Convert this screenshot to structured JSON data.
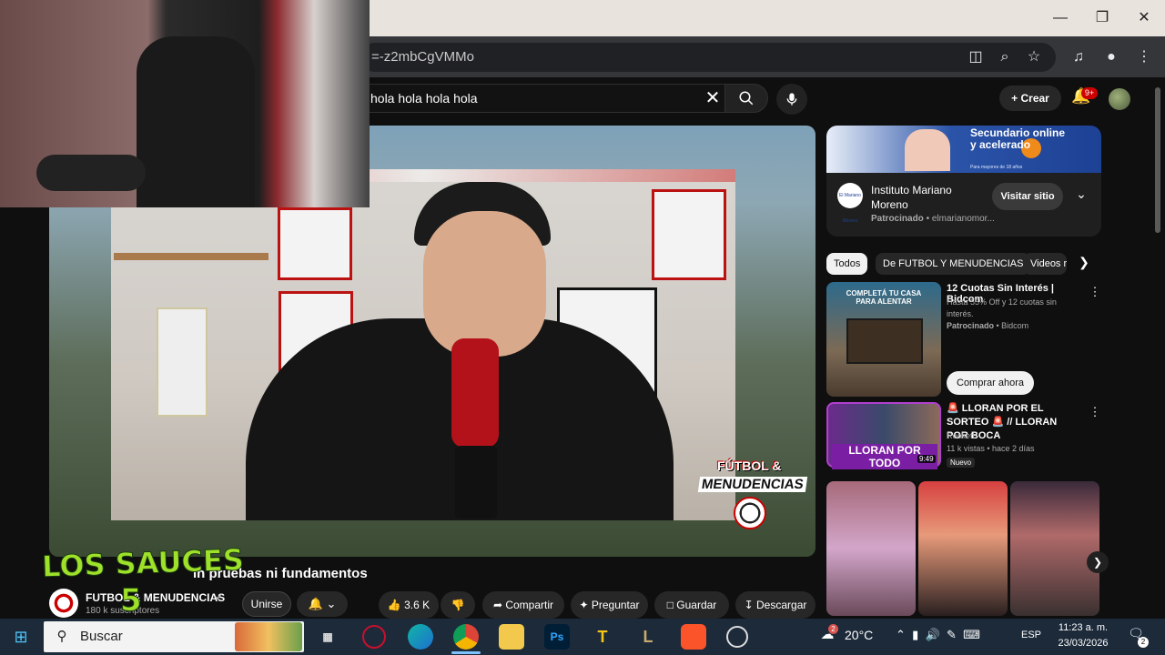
{
  "browser": {
    "url": "=-z2mbCgVMMo"
  },
  "youtube": {
    "search_query": "hola hola hola hola",
    "create_label": "Crear",
    "notifications_badge": "9+"
  },
  "video": {
    "title": "in pruebas ni fundamentos",
    "overlay_logo_line1": "FÚTBOL &",
    "overlay_logo_line2": "MENUDENCIAS",
    "stream_overlay_line1": "LOS SAUCES",
    "stream_overlay_line2": "5",
    "channel": {
      "name": "FUTBOL & MENUDENCIAS",
      "subscribers": "180 k suscriptores"
    },
    "actions": {
      "join": "Unirse",
      "likes": "3.6 K",
      "share": "Compartir",
      "ask": "Preguntar",
      "save": "Guardar",
      "download": "Descargar"
    }
  },
  "sidebar": {
    "ad": {
      "banner_text": "Secundario online y acelerado",
      "banner_small": "Para mayores de 18 años",
      "advertiser": "Instituto Mariano Moreno",
      "logo_text": "El Mariano Moreno",
      "sponsored": "Patrocinado",
      "domain": "elmarianomor...",
      "visit_label": "Visitar sitio"
    },
    "chips": [
      "Todos",
      "De FUTBOL Y MENUDENCIAS",
      "Videos r"
    ],
    "sponsored_rec": {
      "thumb_text": "COMPLETÁ TU CASA PARA ALENTAR",
      "title": "12 Cuotas Sin Interés | Bidcom",
      "description": "Hasta 55% Off y 12 cuotas sin interés.",
      "sponsored": "Patrocinado",
      "advertiser": "Bidcom",
      "cta": "Comprar ahora"
    },
    "video_rec": {
      "thumb_text": "LLORAN POR TODO",
      "duration": "9:49",
      "title": "🚨 LLORAN POR EL SORTEO 🚨 // LLORAN POR BOCA",
      "channel": "Rookett",
      "stats": "11 k vistas • hace 2 días",
      "badge": "Nuevo"
    }
  },
  "taskbar": {
    "search_placeholder": "Buscar",
    "weather_temp": "20°C",
    "weather_badge": "2",
    "language": "ESP",
    "time": "11:23 a. m.",
    "date": "23/03/2026",
    "notifications_count": "2",
    "apps": [
      "opera-gx",
      "edge",
      "chrome",
      "file-explorer",
      "photoshop",
      "app-t",
      "league-of-legends",
      "brave",
      "obs"
    ]
  }
}
